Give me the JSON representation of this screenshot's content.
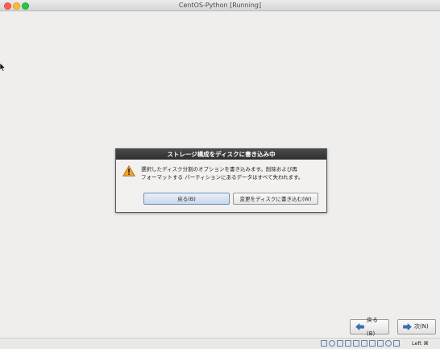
{
  "window": {
    "title": "CentOS-Python [Running]"
  },
  "dialog": {
    "title": "ストレージ構成をディスクに書き込み中",
    "message_line1": "選択したディスク分割のオプションを書き込みます。削除および再",
    "message_line2": "フォーマットする パーティションにあるデータはすべて失われます。",
    "back_label": "戻る(B)",
    "write_label": "変更をディスクに書き込む(W)",
    "icon": "warning-icon"
  },
  "nav": {
    "back_label": "戻る(B)",
    "next_label": "次(N)"
  },
  "statusbar": {
    "host_key": "Left ⌘",
    "icons": [
      "hard-disk-icon",
      "optical-drive-icon",
      "usb-icon",
      "shared-folder-icon",
      "display-icon",
      "network-icon",
      "recording-icon",
      "cpu-icon",
      "mouse-integration-icon"
    ]
  }
}
